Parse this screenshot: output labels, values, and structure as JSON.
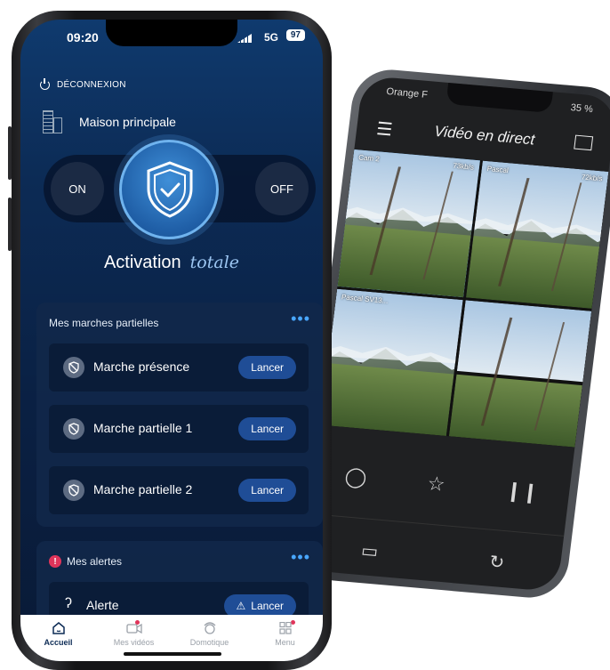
{
  "back_phone": {
    "carrier": "Orange F",
    "battery": "35 %",
    "title": "Vidéo en direct",
    "cameras": [
      {
        "label_left": "Cam 2",
        "label_right": "73kb/s"
      },
      {
        "label_left": "Pascal",
        "label_right": "72kb/s"
      },
      {
        "label_left": "Pascal SV13...",
        "label_right": ""
      },
      {
        "label_left": "",
        "label_right": ""
      }
    ]
  },
  "status": {
    "time": "09:20",
    "network": "5G",
    "battery": "97"
  },
  "logout": {
    "label": "DÉCONNEXION"
  },
  "home": {
    "name": "Maison principale"
  },
  "toggle": {
    "on": "ON",
    "off": "OFF"
  },
  "activation": {
    "label": "Activation",
    "mode": "totale"
  },
  "partial_card": {
    "title": "Mes marches partielles",
    "more": "•••",
    "items": [
      {
        "label": "Marche présence",
        "button": "Lancer"
      },
      {
        "label": "Marche partielle 1",
        "button": "Lancer"
      },
      {
        "label": "Marche partielle 2",
        "button": "Lancer"
      }
    ]
  },
  "alerts_card": {
    "title": "Mes alertes",
    "badge": "!",
    "more": "•••",
    "item": {
      "label": "Alerte",
      "button": "Lancer"
    }
  },
  "tabs": [
    {
      "label": "Accueil",
      "icon": "home-icon",
      "active": true
    },
    {
      "label": "Mes vidéos",
      "icon": "video-icon",
      "active": false
    },
    {
      "label": "Domotique",
      "icon": "home-automation-icon",
      "active": false
    },
    {
      "label": "Menu",
      "icon": "grid-icon",
      "active": false
    }
  ],
  "colors": {
    "accent": "#1f4d96",
    "background": "#0c2b55",
    "alert": "#e0345a",
    "link": "#49a7ff"
  }
}
